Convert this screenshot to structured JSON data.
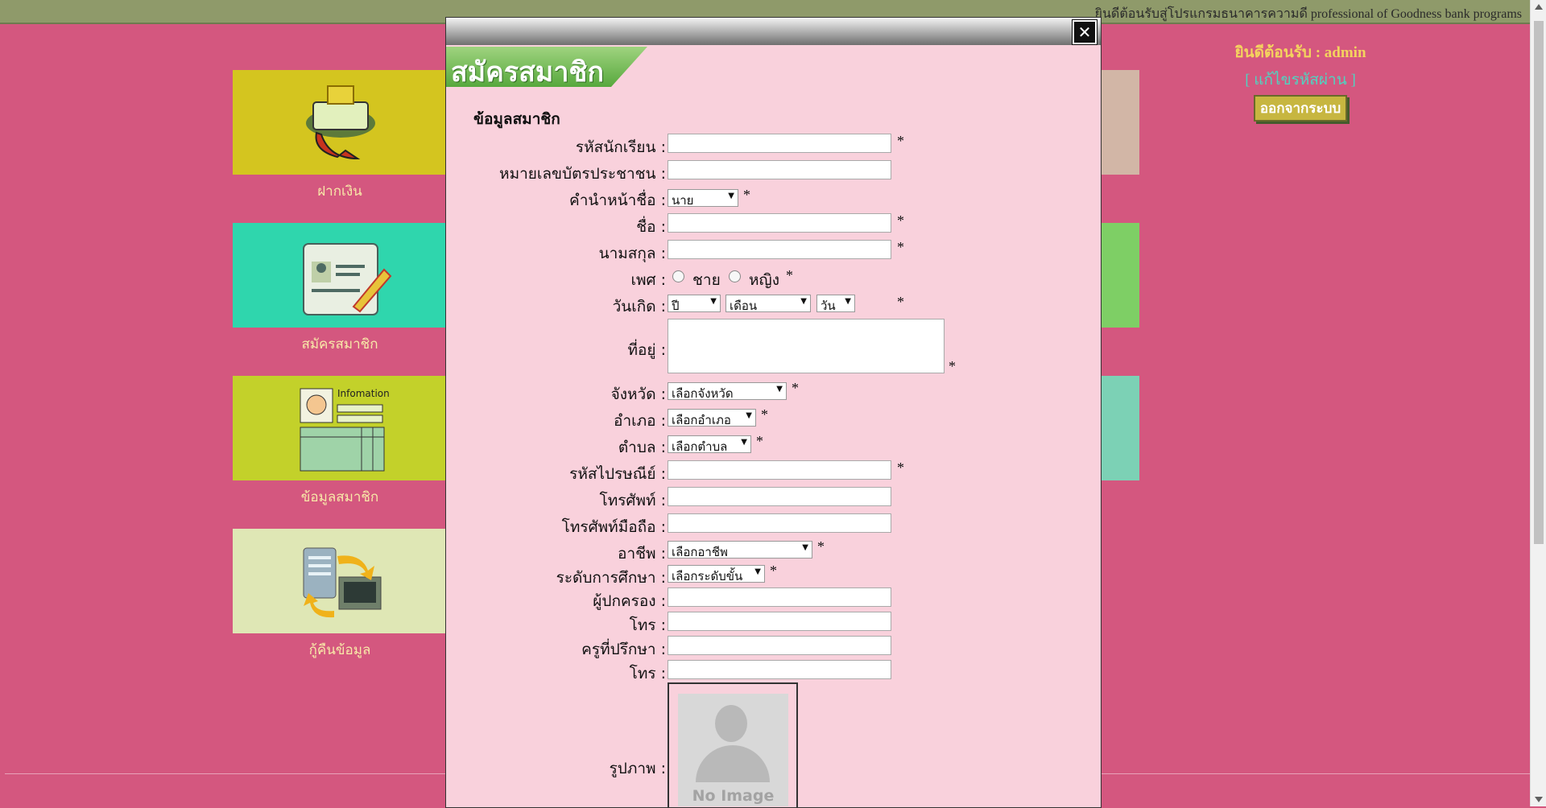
{
  "header": {
    "welcome_text": "ยินดีต้อนรับสู่โปรแกรมธนาคารความดี professional of Goodness bank programs"
  },
  "user": {
    "greeting": "ยินดีต้อนรับ : admin",
    "change_password": "[ แก้ไขรหัสผ่าน ]",
    "logout": "ออกจากระบบ"
  },
  "menu": [
    {
      "label": "ฝากเงิน",
      "color": "#d4c51f",
      "icon": "money-deposit-icon"
    },
    {
      "label": "สมัครสมาชิก",
      "color": "#2fd6ad",
      "icon": "member-register-icon"
    },
    {
      "label": "ข้อมูลสมาชิก",
      "color": "#c3d12a",
      "icon": "member-info-icon"
    },
    {
      "label": "กู้คืนข้อมูล",
      "color": "#dfe7b5",
      "icon": "data-restore-icon"
    }
  ],
  "modal": {
    "title": "สมัครสมาชิก",
    "section": "ข้อมูลสมาชิก",
    "labels": {
      "student_id": "รหัสนักเรียน :",
      "citizen_id": "หมายเลขบัตรประชาชน :",
      "prefix": "คำนำหน้าชื่อ :",
      "first_name": "ชื่อ :",
      "last_name": "นามสกุล :",
      "gender": "เพศ :",
      "birthdate": "วันเกิด :",
      "address": "ที่อยู่ :",
      "province": "จังหวัด :",
      "district": "อำเภอ :",
      "subdistrict": "ตำบล :",
      "postcode": "รหัสไปรษณีย์ :",
      "phone": "โทรศัพท์ :",
      "mobile": "โทรศัพท์มือถือ :",
      "occupation": "อาชีพ :",
      "education": "ระดับการศึกษา :",
      "guardian": "ผู้ปกครอง :",
      "guardian_phone": "โทร :",
      "advisor": "ครูที่ปรึกษา :",
      "advisor_phone": "โทร :",
      "photo": "รูปภาพ :"
    },
    "values": {
      "prefix": "นาย",
      "year": "ปี",
      "month": "เดือน",
      "day": "วัน",
      "province": "เลือกจังหวัด",
      "district": "เลือกอำเภอ",
      "subdistrict": "เลือกตำบล",
      "occupation": "เลือกอาชีพ",
      "education": "เลือกระดับขั้น"
    },
    "gender_options": [
      "ชาย",
      "หญิง"
    ],
    "required_mark": "*",
    "photo_placeholder": "No Image",
    "close_icon": "✕"
  }
}
